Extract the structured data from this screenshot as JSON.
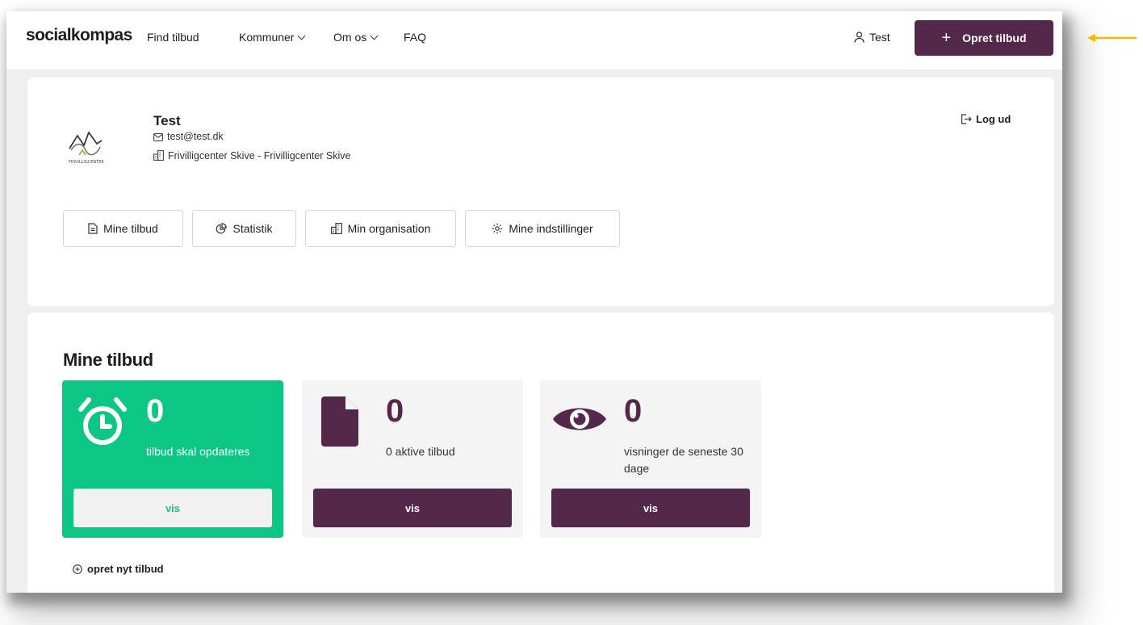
{
  "header": {
    "logo": "socialkompas",
    "nav": [
      {
        "label": "Find tilbud",
        "dropdown": false
      },
      {
        "label": "Kommuner",
        "dropdown": true
      },
      {
        "label": "Om os",
        "dropdown": true
      },
      {
        "label": "FAQ",
        "dropdown": false
      }
    ],
    "user_label": "Test",
    "cta_label": "Opret tilbud"
  },
  "profile": {
    "name": "Test",
    "email": "test@test.dk",
    "organisation": "Frivilligcenter Skive - Frivilligcenter Skive",
    "logout_label": "Log ud",
    "org_logo_text": "FRIVILLIGCENTER",
    "tabs": [
      {
        "label": "Mine tilbud",
        "icon": "document-icon"
      },
      {
        "label": "Statistik",
        "icon": "pie-chart-icon"
      },
      {
        "label": "Min organisation",
        "icon": "building-icon"
      },
      {
        "label": "Mine indstillinger",
        "icon": "gear-icon"
      }
    ]
  },
  "offers": {
    "title": "Mine tilbud",
    "stats": [
      {
        "count": "0",
        "label": "tilbud skal opdateres",
        "button": "vis",
        "icon": "alarm-clock-icon",
        "highlight": true
      },
      {
        "count": "0",
        "label": "0 aktive tilbud",
        "button": "vis",
        "icon": "file-icon",
        "highlight": false
      },
      {
        "count": "0",
        "label": "visninger de seneste 30 dage",
        "button": "vis",
        "icon": "eye-icon",
        "highlight": false
      }
    ],
    "new_offer_label": "opret nyt tilbud"
  },
  "colors": {
    "primary": "#54284a",
    "accent_green": "#0cc783",
    "annotation_arrow": "#f5b800"
  }
}
